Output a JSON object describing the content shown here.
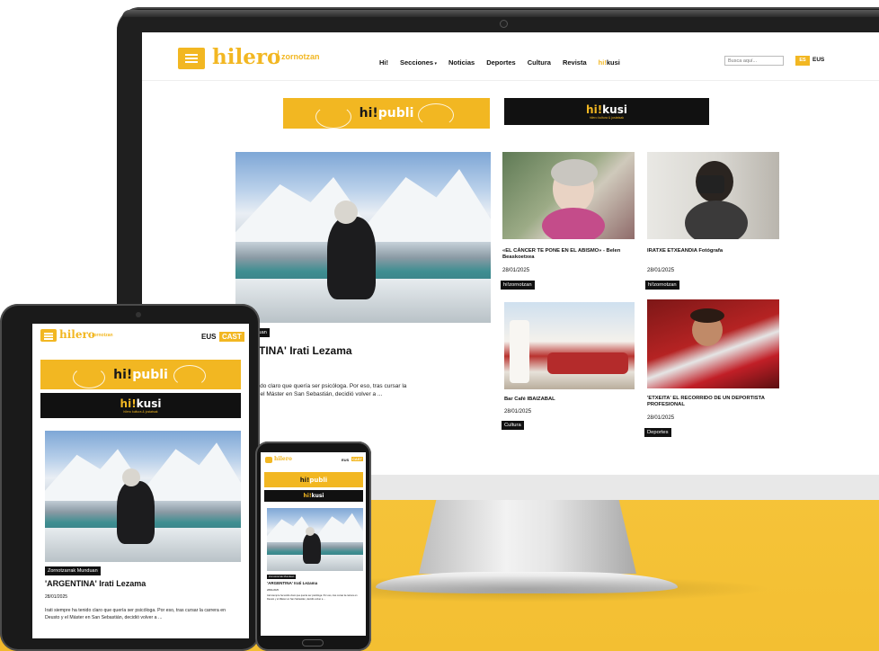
{
  "brand": {
    "name": "hilero",
    "sub": "zornotzan"
  },
  "nav": {
    "items": [
      "Hi!",
      "Secciones",
      "Noticias",
      "Deportes",
      "Cultura",
      "Revista"
    ],
    "kusi_hi": "hi!",
    "kusi_rest": "kusi"
  },
  "search": {
    "placeholder": "Busca aquí..."
  },
  "lang": {
    "es": "ES",
    "eus": "EUS",
    "cast": "CAST"
  },
  "banners": {
    "publi_hi": "hi!",
    "publi_rest": "publi",
    "kusi_hi": "hi!",
    "kusi_rest": "kusi",
    "kusi_tagline": "hilero kultura & jostatsak"
  },
  "featured": {
    "tag": "Zornotzarrak Munduan",
    "tag_visible": "ak Munduan",
    "title": "'ARGENTINA' Irati Lezama",
    "title_visible": "GENTINA' Irati Lezama",
    "date": "28/01/2025",
    "excerpt": "Irati siempre ha tenido claro que quería ser psicóloga. Por eso, tras cursar la carrera en Deusto y el Máster en San Sebastián, decidió volver a ...",
    "excerpt_visible_1": "re ha tenido claro que quería ser psicóloga. Por eso, tras cursar la",
    "excerpt_visible_2": "Deusto y el Máster en San Sebastián, decidió volver a ..."
  },
  "articles": [
    {
      "title": "«EL CÁNCER TE PONE EN EL ABISMO» - Belen Beaskoetxea",
      "date": "28/01/2025",
      "tag": "hi!zornotzan"
    },
    {
      "title": "IRATXE ETXEANDIA Fotógrafa",
      "date": "28/01/2025",
      "tag": "hi!zornotzan"
    },
    {
      "title": "Bar Café IBAIZABAL",
      "date": "28/01/2025",
      "tag": "Cultura"
    },
    {
      "title": "'ETXEITA' EL RECORRIDO DE UN DEPORTISTA PROFESIONAL",
      "date": "28/01/2025",
      "tag": "Deportes"
    }
  ]
}
